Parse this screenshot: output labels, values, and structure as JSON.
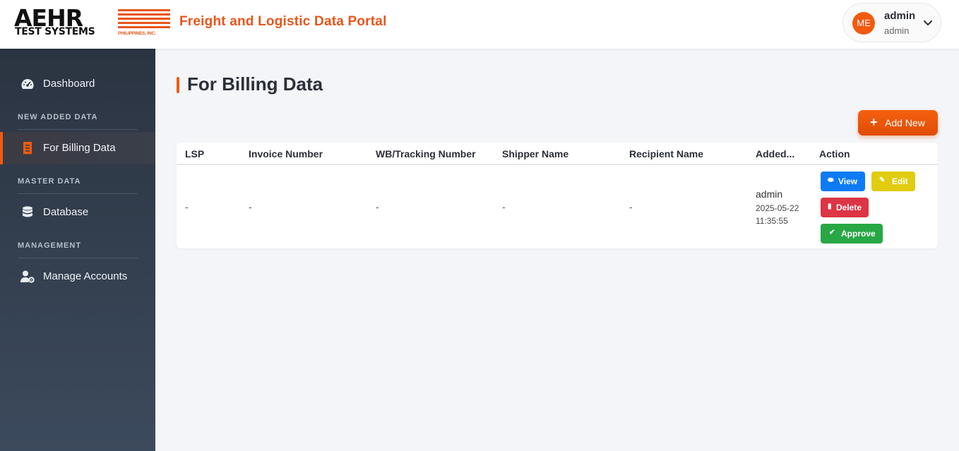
{
  "header": {
    "logo_main": "AEHR",
    "logo_sub": "TEST SYSTEMS",
    "logo_tag": "PHILIPPINES, INC.",
    "portal_title": "Freight and Logistic Data Portal",
    "user": {
      "initials": "ME",
      "name": "admin",
      "role": "admin",
      "dropdown_icon": "chevron-down-icon"
    }
  },
  "sidebar": {
    "dashboard": {
      "label": "Dashboard",
      "icon": "gauge-icon"
    },
    "sections": [
      {
        "title": "NEW ADDED DATA",
        "items": [
          {
            "label": "For Billing Data",
            "icon": "receipt-icon",
            "active": true
          }
        ]
      },
      {
        "title": "MASTER DATA",
        "items": [
          {
            "label": "Database",
            "icon": "database-icon"
          }
        ]
      },
      {
        "title": "MANAGEMENT",
        "items": [
          {
            "label": "Manage Accounts",
            "icon": "user-gear-icon"
          }
        ]
      }
    ]
  },
  "main": {
    "title": "For Billing Data",
    "add_button": "Add New",
    "table": {
      "columns": [
        "LSP",
        "Invoice Number",
        "WB/Tracking Number",
        "Shipper Name",
        "Recipient Name",
        "Added...",
        "Action"
      ],
      "rows": [
        {
          "lsp": "-",
          "invoice_number": "-",
          "tracking_number": "-",
          "shipper_name": "-",
          "recipient_name": "-",
          "added_by": "admin",
          "added_at": "2025-05-22 11:35:55"
        }
      ],
      "actions": {
        "view": "View",
        "edit": "Edit",
        "delete": "Delete",
        "approve": "Approve"
      }
    }
  },
  "colors": {
    "accent": "#f25a0f",
    "sidebar_top": "#2b3441",
    "sidebar_bottom": "#3c4a5d",
    "view": "#0d7bf5",
    "edit": "#e1cc0f",
    "delete": "#dc3545",
    "approve": "#28a745"
  }
}
